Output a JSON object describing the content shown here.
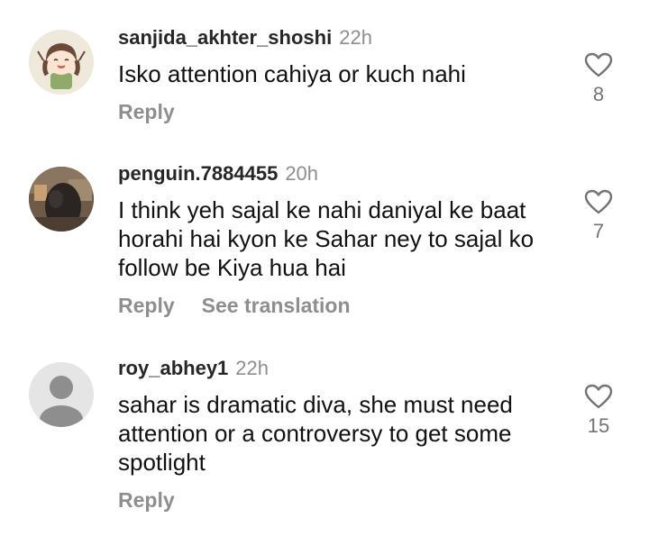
{
  "comments": [
    {
      "username": "sanjida_akhter_shoshi",
      "time": "22h",
      "text": "Isko attention cahiya or kuch nahi",
      "reply_label": "Reply",
      "see_translation_label": "",
      "like_count": "8",
      "avatar_type": "cartoon-girl-avatar"
    },
    {
      "username": "penguin.7884455",
      "time": "20h",
      "text": "I think yeh sajal ke nahi daniyal ke baat horahi hai kyon ke Sahar ney to sajal ko follow be Kiya hua hai",
      "reply_label": "Reply",
      "see_translation_label": "See translation",
      "like_count": "7",
      "avatar_type": "photo-avatar"
    },
    {
      "username": "roy_abhey1",
      "time": "22h",
      "text": "sahar is dramatic diva, she must need attention or a controversy to get some spotlight",
      "reply_label": "Reply",
      "see_translation_label": "",
      "like_count": "15",
      "avatar_type": "default-avatar"
    }
  ],
  "icons": {
    "like": "heart-outline-icon"
  },
  "colors": {
    "username": "#262626",
    "secondary": "#8e8e8e",
    "text": "#111111"
  }
}
